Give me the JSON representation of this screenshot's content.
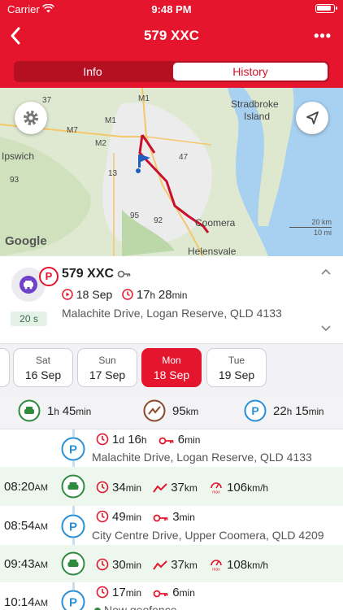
{
  "status_bar": {
    "carrier": "Carrier",
    "time": "9:48 PM"
  },
  "nav": {
    "title": "579 XXC"
  },
  "tabs": [
    {
      "label": "Info",
      "selected": false
    },
    {
      "label": "History",
      "selected": true
    }
  ],
  "map": {
    "place_labels": [
      "Ipswich",
      "Stradbroke",
      "Island",
      "Coomera",
      "Helensvale"
    ],
    "road_labels": [
      "M1",
      "M7",
      "M2",
      "13",
      "93",
      "95",
      "92",
      "47",
      "37",
      "M1"
    ],
    "scale_km": "20 km",
    "scale_mi": "10 mi",
    "attribution": "Google",
    "route_color": "#c8102e"
  },
  "vehicle": {
    "plate": "579 XXC",
    "date": "18 Sep",
    "duration_h": "17",
    "duration_h_unit": "h",
    "duration_m": "28",
    "duration_m_unit": "min",
    "address": "Malachite Drive, Logan Reserve, QLD 4133",
    "stop_duration": "20 s",
    "badge": "P"
  },
  "dates": [
    {
      "dow": "Sat",
      "date": "16 Sep"
    },
    {
      "dow": "Sun",
      "date": "17 Sep"
    },
    {
      "dow": "Mon",
      "date": "18 Sep",
      "selected": true
    },
    {
      "dow": "Tue",
      "date": "19 Sep"
    }
  ],
  "summary": {
    "drive_h": "1",
    "drive_h_unit": "h",
    "drive_m": "45",
    "drive_m_unit": "min",
    "distance": "95",
    "distance_unit": "km",
    "park_h": "22",
    "park_h_unit": "h",
    "park_m": "15",
    "park_m_unit": "min"
  },
  "timeline": [
    {
      "type": "park",
      "time": "",
      "duration": "1",
      "duration_unit": "d",
      "duration2": "16",
      "duration2_unit": "h",
      "idle": "6",
      "idle_unit": "min",
      "address": "Malachite Drive, Logan Reserve, QLD 4133"
    },
    {
      "type": "drive",
      "time": "08:20",
      "ampm": "AM",
      "duration": "34",
      "duration_unit": "min",
      "distance": "37",
      "distance_unit": "km",
      "max_speed": "106",
      "speed_unit": "km/h"
    },
    {
      "type": "park",
      "time": "08:54",
      "ampm": "AM",
      "duration": "49",
      "duration_unit": "min",
      "idle": "3",
      "idle_unit": "min",
      "address": "City Centre Drive, Upper Coomera, QLD 4209"
    },
    {
      "type": "drive",
      "time": "09:43",
      "ampm": "AM",
      "duration": "30",
      "duration_unit": "min",
      "distance": "37",
      "distance_unit": "km",
      "max_speed": "108",
      "speed_unit": "km/h"
    },
    {
      "type": "park",
      "time": "10:14",
      "ampm": "AM",
      "duration": "17",
      "duration_unit": "min",
      "idle": "6",
      "idle_unit": "min",
      "geofence": "New geofence"
    }
  ],
  "colors": {
    "brand_red": "#e4152c",
    "park_blue": "#2b8fd6",
    "drive_green": "#2e8b3d",
    "distance_brown": "#8a4a2a"
  },
  "icons": [
    "back-arrow-icon",
    "more-icon",
    "settings-gear-icon",
    "location-arrow-icon",
    "car-icon",
    "key-icon",
    "play-icon",
    "clock-icon",
    "chevron-up-icon",
    "chevron-down-icon",
    "parking-icon",
    "trend-icon",
    "speedometer-icon"
  ]
}
